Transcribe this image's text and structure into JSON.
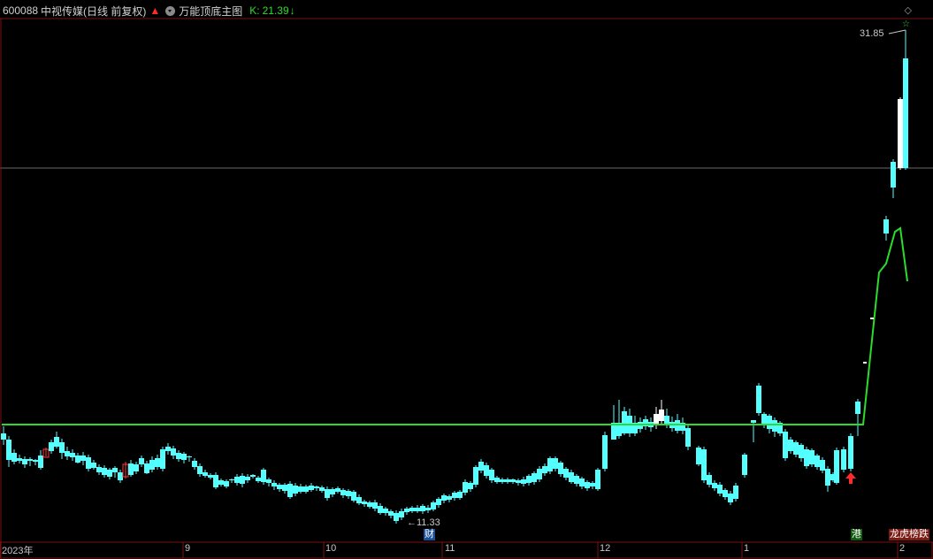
{
  "header": {
    "code": "600088",
    "title": "中视传媒(日线 前复权)",
    "indicator": "万能顶底主图",
    "k_label": "K:",
    "k_value": "21.39",
    "arrow_up": "🡅",
    "arrow_down": "↓"
  },
  "price_labels": {
    "high": "31.85",
    "low": "11.33"
  },
  "x_axis": {
    "year": "2023年",
    "months": [
      "9",
      "10",
      "11",
      "12",
      "1",
      "2"
    ]
  },
  "event_tags": {
    "gang": "港",
    "lhb": "龙虎榜跌",
    "cai": "财"
  },
  "top_icon": "diamond-icon",
  "star": "☆",
  "colors": {
    "background": "#000000",
    "up": "#ff3c3c",
    "down": "#54ffff",
    "line": "#2bdc2b",
    "grid": "#7a1010"
  },
  "chart_data": {
    "type": "candlestick",
    "title": "中视传媒(日线 前复权)",
    "indicator": "万能顶底主图",
    "indicator_line_K_last": 21.39,
    "price_range_visible": [
      11.33,
      31.85
    ],
    "x_ticks": [
      "2023年",
      "9",
      "10",
      "11",
      "12",
      "1",
      "2"
    ],
    "annotations": [
      "31.85",
      "11.33"
    ]
  }
}
